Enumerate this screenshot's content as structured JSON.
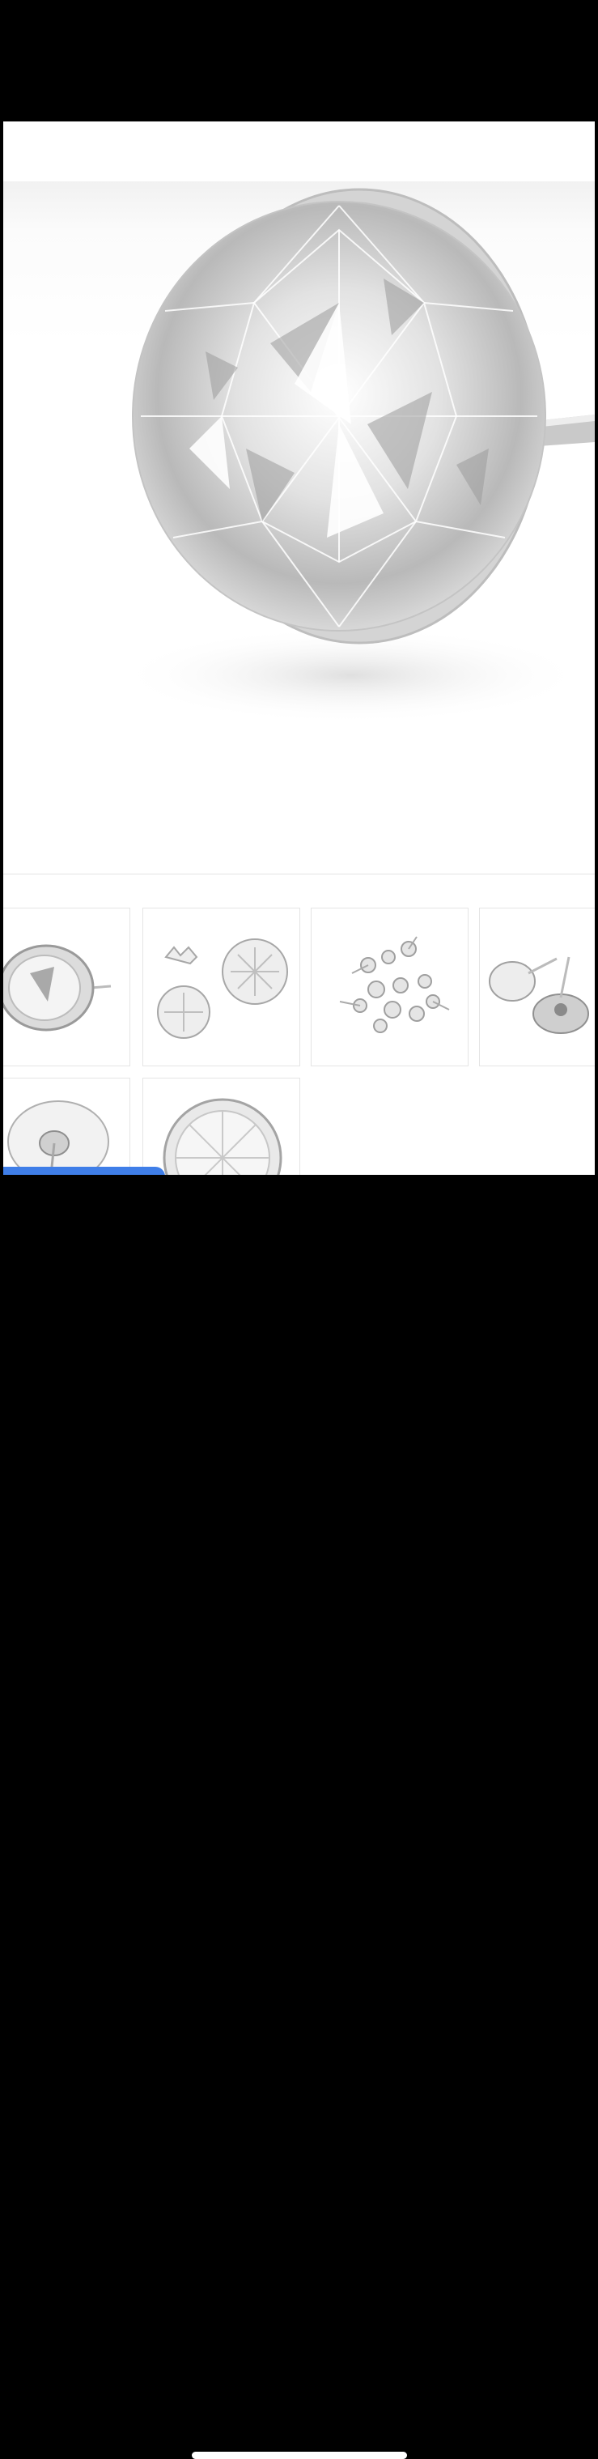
{
  "product": {
    "main_image": "crystal-upholstery-tack",
    "thumbnails": [
      "crystal-tack-side-view",
      "flower-tack-bases",
      "assorted-tacks-pile",
      "tack-and-nail-back",
      "tack-back-with-pin",
      "crystal-tack-front-view"
    ]
  },
  "colors": {
    "accent": "#3f7ee8",
    "background": "#ffffff",
    "thumb_border": "#e4e4e4"
  }
}
